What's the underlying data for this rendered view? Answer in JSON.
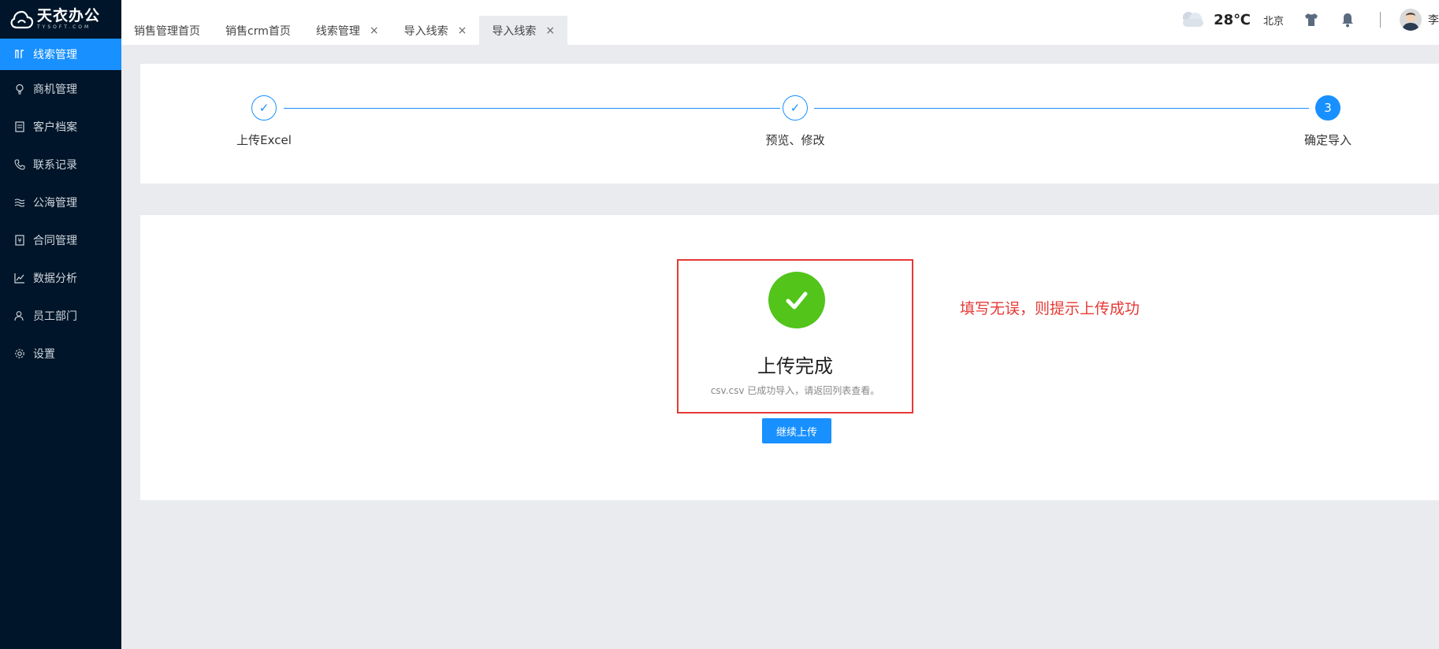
{
  "brand": {
    "name": "天衣办公",
    "sub": "TYSOFT.COM"
  },
  "sidebar": {
    "items": [
      {
        "label": "线索管理",
        "icon": "clue-icon",
        "active": true
      },
      {
        "label": "商机管理",
        "icon": "lightbulb-icon"
      },
      {
        "label": "客户档案",
        "icon": "file-icon"
      },
      {
        "label": "联系记录",
        "icon": "phone-icon"
      },
      {
        "label": "公海管理",
        "icon": "sea-icon"
      },
      {
        "label": "合同管理",
        "icon": "contract-icon"
      },
      {
        "label": "数据分析",
        "icon": "chart-icon"
      },
      {
        "label": "员工部门",
        "icon": "users-icon"
      },
      {
        "label": "设置",
        "icon": "gear-icon"
      }
    ]
  },
  "tabs": [
    {
      "label": "销售管理首页",
      "closable": false
    },
    {
      "label": "销售crm首页",
      "closable": false
    },
    {
      "label": "线索管理",
      "closable": true
    },
    {
      "label": "导入线索",
      "closable": true
    },
    {
      "label": "导入线索",
      "closable": true,
      "active": true
    }
  ],
  "tab_close_glyph": "×",
  "header": {
    "temp": "28℃",
    "city": "北京",
    "user": "李"
  },
  "steps": [
    {
      "label": "上传Excel",
      "status": "done",
      "mark": "✓"
    },
    {
      "label": "预览、修改",
      "status": "done",
      "mark": "✓"
    },
    {
      "label": "确定导入",
      "status": "current",
      "mark": "3"
    }
  ],
  "result": {
    "title": "上传完成",
    "subtitle": "csv.csv 已成功导入，请返回列表查看。",
    "button": "继续上传"
  },
  "annotation": "填写无误，则提示上传成功",
  "colors": {
    "sidebar": "#001529",
    "primary": "#1890ff",
    "success": "#52c41a",
    "annotation": "#e53935"
  }
}
